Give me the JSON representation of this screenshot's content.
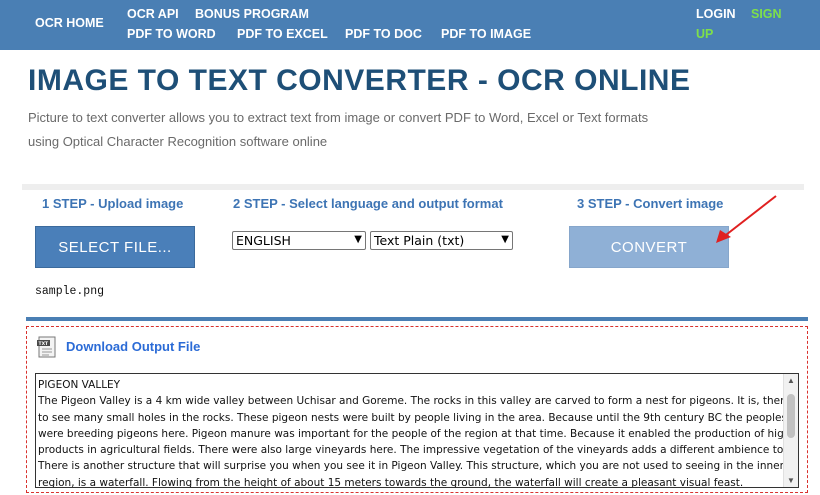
{
  "nav": {
    "home": "OCR HOME",
    "api": "OCR API",
    "bonus": "BONUS PROGRAM",
    "pdf_word": "PDF TO WORD",
    "pdf_excel": "PDF TO EXCEL",
    "pdf_doc": "PDF TO DOC",
    "pdf_image": "PDF TO IMAGE",
    "login": "LOGIN",
    "sign": "SIGN",
    "up": "UP"
  },
  "header": {
    "title": "IMAGE TO TEXT CONVERTER - OCR ONLINE",
    "desc_line1": "Picture to text converter allows you to extract text from image or convert PDF to Word, Excel or Text formats",
    "desc_line2": "using Optical Character Recognition software online"
  },
  "steps": {
    "step1": "1 STEP - Upload image",
    "step2": "2 STEP - Select language and output format",
    "step3": "3 STEP - Convert image"
  },
  "controls": {
    "select_file_label": "SELECT FILE...",
    "language": "ENGLISH",
    "format": "Text Plain (txt)",
    "convert_label": "CONVERT",
    "file_name": "sample.png"
  },
  "output": {
    "download_label": "Download Output File",
    "lines": [
      "PIGEON VALLEY",
      "The Pigeon Valley is a 4 km wide valley between Uchisar and Goreme. The rocks in this valley are carved to form a nest for pigeons. It is, therefore, possible",
      "to see many small holes in the rocks. These pigeon nests were built by people living in the area. Because until the 9th century BC the peoples of the region",
      "were breeding pigeons here. Pigeon manure was important for the people of the region at that time. Because it enabled the production of higher quality",
      "products in agricultural fields. There were also large vineyards here. The impressive vegetation of the vineyards adds a different ambience to the valley.",
      "There is another structure that will surprise you when you see it in Pigeon Valley. This structure, which you are not used to seeing in the inner Anatolia",
      "region, is a waterfall. Flowing from the height of about 15 meters towards the ground, the waterfall will create a pleasant visual feast."
    ]
  },
  "colors": {
    "topbar": "#4a7fb4",
    "title": "#1e4f77",
    "accent_green": "#7ee04a",
    "link": "#2b6bd6",
    "annotation_red": "#d9322e"
  },
  "icons": {
    "doc": "txt-file-icon",
    "arrow": "annotation-arrow-icon"
  }
}
